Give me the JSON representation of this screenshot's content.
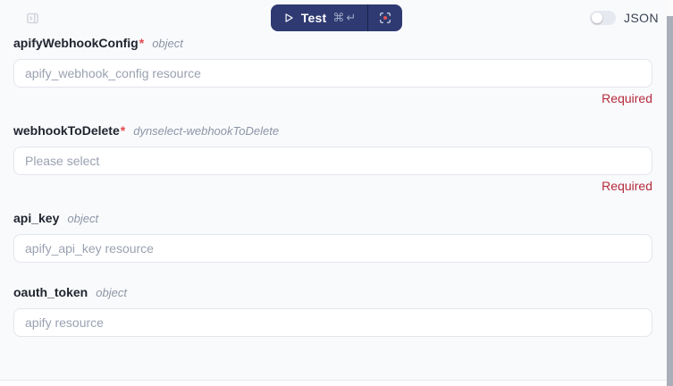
{
  "header": {
    "test_button": {
      "label": "Test",
      "shortcut": "⌘↵",
      "background_color": "#2e3a71",
      "icons": [
        "play-icon",
        "focus-target-icon"
      ]
    },
    "json_toggle": {
      "label": "JSON",
      "state": "off"
    },
    "panel_toggle_icon": "panel-expand-icon"
  },
  "required_marker": "*",
  "fields": [
    {
      "name": "apifyWebhookConfig",
      "type": "object",
      "required": true,
      "control": "input",
      "value": "",
      "placeholder": "apify_webhook_config resource",
      "error": "Required"
    },
    {
      "name": "webhookToDelete",
      "type": "dynselect-webhookToDelete",
      "required": true,
      "control": "select",
      "value": "",
      "placeholder": "Please select",
      "error": "Required"
    },
    {
      "name": "api_key",
      "type": "object",
      "required": false,
      "control": "input",
      "value": "",
      "placeholder": "apify_api_key resource",
      "error": null
    },
    {
      "name": "oauth_token",
      "type": "object",
      "required": false,
      "control": "input",
      "value": "",
      "placeholder": "apify resource",
      "error": null
    }
  ],
  "colors": {
    "page_background": "#f9fafc",
    "button_navy": "#2e3a71",
    "error_red": "#b42b3c",
    "asterisk_red": "#e5484d",
    "record_dot_red": "#e25555",
    "scrollbar_thumb": "#a9aeb9"
  }
}
